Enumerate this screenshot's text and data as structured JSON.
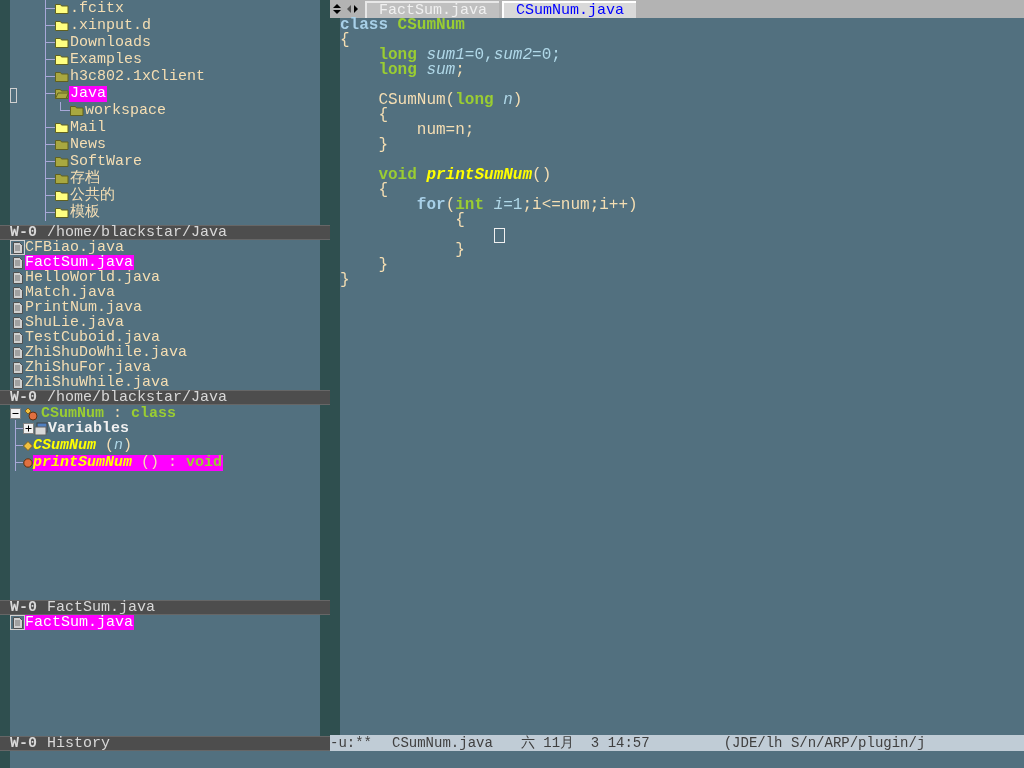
{
  "directory_pane": {
    "items": [
      {
        "name": ".fcitx",
        "color": "#ffff80",
        "expanded": false,
        "selected": false,
        "cursor": false
      },
      {
        "name": ".xinput.d",
        "color": "#ffff80",
        "expanded": false,
        "selected": false,
        "cursor": false
      },
      {
        "name": "Downloads",
        "color": "#ffff80",
        "expanded": false,
        "selected": false,
        "cursor": false
      },
      {
        "name": "Examples",
        "color": "#ffff80",
        "expanded": false,
        "selected": false,
        "cursor": false
      },
      {
        "name": "h3c802.1xClient",
        "color": "#a8a840",
        "expanded": false,
        "selected": false,
        "cursor": false
      },
      {
        "name": "Java",
        "color": "#a8a840",
        "expanded": true,
        "selected": true,
        "cursor": true,
        "children": [
          {
            "name": "workspace",
            "color": "#a8a840",
            "expanded": false,
            "selected": false
          }
        ]
      },
      {
        "name": "Mail",
        "color": "#ffff80",
        "expanded": false,
        "selected": false,
        "cursor": false
      },
      {
        "name": "News",
        "color": "#a8a840",
        "expanded": false,
        "selected": false,
        "cursor": false
      },
      {
        "name": "SoftWare",
        "color": "#a8a840",
        "expanded": false,
        "selected": false,
        "cursor": false
      },
      {
        "name": "存档",
        "color": "#a8a840",
        "expanded": false,
        "selected": false,
        "cursor": false
      },
      {
        "name": "公共的",
        "color": "#ffff80",
        "expanded": false,
        "selected": false,
        "cursor": false
      },
      {
        "name": "模板",
        "color": "#ffff80",
        "expanded": false,
        "selected": false,
        "cursor": false
      }
    ],
    "header": {
      "label": "W-0",
      "path": "/home/blackstar/Java"
    }
  },
  "sources_pane": {
    "items": [
      {
        "name": "CFBiao.java",
        "selected": false,
        "cursor": true
      },
      {
        "name": "FactSum.java",
        "selected": true,
        "cursor": false
      },
      {
        "name": "HelloWorld.java",
        "selected": false,
        "cursor": false
      },
      {
        "name": "Match.java",
        "selected": false,
        "cursor": false
      },
      {
        "name": "PrintNum.java",
        "selected": false,
        "cursor": false
      },
      {
        "name": "ShuLie.java",
        "selected": false,
        "cursor": false
      },
      {
        "name": "TestCuboid.java",
        "selected": false,
        "cursor": false
      },
      {
        "name": "ZhiShuDoWhile.java",
        "selected": false,
        "cursor": false
      },
      {
        "name": "ZhiShuFor.java",
        "selected": false,
        "cursor": false
      },
      {
        "name": "ZhiShuWhile.java",
        "selected": false,
        "cursor": false
      }
    ],
    "header": {
      "label": "W-0",
      "path": "/home/blackstar/Java"
    }
  },
  "methods_pane": {
    "root": {
      "expanded": true,
      "selected": false,
      "tokens": [
        {
          "text": "CSumNum",
          "kind": "type"
        },
        {
          "text": " : ",
          "kind": "plain"
        },
        {
          "text": "class",
          "kind": "typename"
        }
      ],
      "children": [
        {
          "kind": "group",
          "expanded": false,
          "selected": false,
          "tokens": [
            {
              "text": "Variables",
              "kind": "bold"
            }
          ]
        },
        {
          "kind": "constructor",
          "selected": false,
          "tokens": [
            {
              "text": "CSumNum",
              "kind": "function"
            },
            {
              "text": " (",
              "kind": "plain"
            },
            {
              "text": "n",
              "kind": "variable"
            },
            {
              "text": ")",
              "kind": "plain"
            }
          ]
        },
        {
          "kind": "method",
          "selected": true,
          "tokens": [
            {
              "text": "printSumNum",
              "kind": "function"
            },
            {
              "text": " () : ",
              "kind": "plain"
            },
            {
              "text": "void",
              "kind": "typename"
            }
          ]
        }
      ]
    },
    "header": {
      "label": "W-0",
      "path": "FactSum.java"
    }
  },
  "history_pane": {
    "items": [
      {
        "name": "FactSum.java",
        "selected": true,
        "cursor": true
      }
    ],
    "header": {
      "label": "W-0",
      "path": "History"
    }
  },
  "tabs": [
    {
      "label": "FactSum.java",
      "selected": false
    },
    {
      "label": "CSumNum.java",
      "selected": true
    }
  ],
  "code": {
    "lines": [
      {
        "kind": "code",
        "tokens": [
          {
            "text": "class",
            "kind": "keyword"
          },
          {
            "text": " CSumNum",
            "kind": "type"
          }
        ]
      },
      {
        "kind": "code",
        "tokens": [
          {
            "text": "{",
            "kind": "plain"
          }
        ]
      },
      {
        "kind": "code",
        "tokens": [
          {
            "text": "    long",
            "kind": "type"
          },
          {
            "text": " sum1",
            "kind": "variable"
          },
          {
            "text": "=0,",
            "kind": "number"
          },
          {
            "text": "sum2",
            "kind": "variable"
          },
          {
            "text": "=0;",
            "kind": "number"
          }
        ]
      },
      {
        "kind": "code",
        "tokens": [
          {
            "text": "    long",
            "kind": "type"
          },
          {
            "text": " sum",
            "kind": "variable"
          },
          {
            "text": ";",
            "kind": "plain"
          }
        ]
      },
      {
        "kind": "blank"
      },
      {
        "kind": "code",
        "tokens": [
          {
            "text": "    CSumNum(",
            "kind": "plain"
          },
          {
            "text": "long",
            "kind": "type"
          },
          {
            "text": " n",
            "kind": "variable"
          },
          {
            "text": ")",
            "kind": "plain"
          }
        ]
      },
      {
        "kind": "code",
        "tokens": [
          {
            "text": "    {",
            "kind": "plain"
          }
        ]
      },
      {
        "kind": "code",
        "tokens": [
          {
            "text": "        num=n;",
            "kind": "plain"
          }
        ]
      },
      {
        "kind": "code",
        "tokens": [
          {
            "text": "    }",
            "kind": "plain"
          }
        ]
      },
      {
        "kind": "blank"
      },
      {
        "kind": "code",
        "tokens": [
          {
            "text": "    void",
            "kind": "type"
          },
          {
            "text": " printSumNum",
            "kind": "function"
          },
          {
            "text": "()",
            "kind": "plain"
          }
        ]
      },
      {
        "kind": "code",
        "tokens": [
          {
            "text": "    {",
            "kind": "plain"
          }
        ]
      },
      {
        "kind": "code",
        "tokens": [
          {
            "text": "        for",
            "kind": "keyword"
          },
          {
            "text": "(",
            "kind": "plain"
          },
          {
            "text": "int",
            "kind": "type"
          },
          {
            "text": " i",
            "kind": "variable"
          },
          {
            "text": "=1",
            "kind": "number"
          },
          {
            "text": ";i<=num;i++)",
            "kind": "plain"
          }
        ]
      },
      {
        "kind": "code",
        "tokens": [
          {
            "text": "            {",
            "kind": "plain"
          }
        ]
      },
      {
        "kind": "code",
        "tokens": [
          {
            "kind": "cursor"
          }
        ]
      },
      {
        "kind": "code",
        "tokens": [
          {
            "text": "            }",
            "kind": "plain"
          }
        ]
      },
      {
        "kind": "code",
        "tokens": [
          {
            "text": "    }",
            "kind": "plain"
          }
        ]
      },
      {
        "kind": "code",
        "tokens": [
          {
            "text": "}",
            "kind": "plain"
          }
        ]
      }
    ]
  },
  "mode_line": {
    "status": "-u:**",
    "buffer": "CSumNum.java",
    "time": "六 11月  3 14:57",
    "modes": "(JDE/lh S/n/ARP/plugin/j"
  }
}
